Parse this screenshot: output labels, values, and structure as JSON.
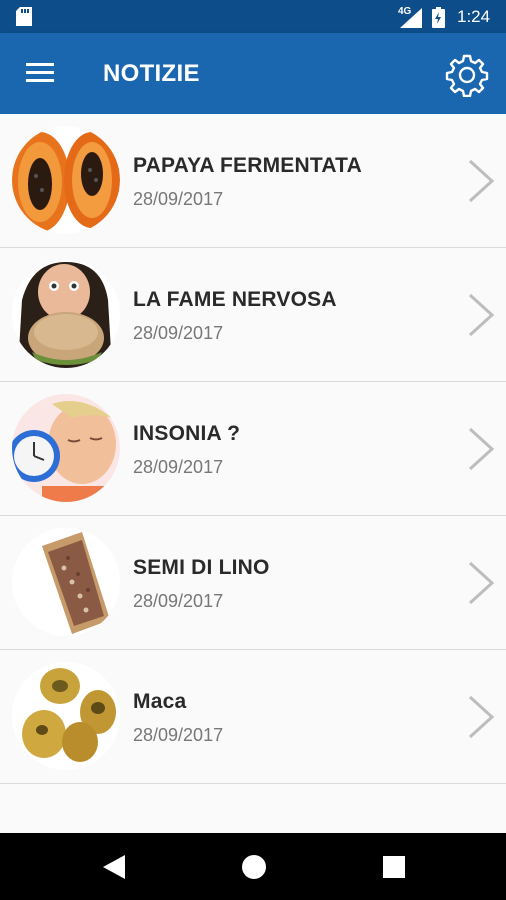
{
  "status_bar": {
    "network": "4G",
    "time": "1:24"
  },
  "app_bar": {
    "title": "NOTIZIE",
    "menu_icon": "hamburger-menu-icon",
    "settings_icon": "gear-icon"
  },
  "news": [
    {
      "title": "PAPAYA FERMENTATA",
      "date": "28/09/2017",
      "image": "papaya"
    },
    {
      "title": "LA FAME NERVOSA",
      "date": "28/09/2017",
      "image": "person-eating-bread"
    },
    {
      "title": "INSONIA ?",
      "date": "28/09/2017",
      "image": "sleeping-woman-alarm-clock"
    },
    {
      "title": "SEMI DI LINO",
      "date": "28/09/2017",
      "image": "flax-seeds-scoop"
    },
    {
      "title": "Maca",
      "date": "28/09/2017",
      "image": "maca-roots"
    }
  ],
  "nav_bar": {
    "back_icon": "back-triangle-icon",
    "home_icon": "home-circle-icon",
    "recents_icon": "recents-square-icon"
  },
  "colors": {
    "status_bar": "#0d4d8a",
    "app_bar": "#1a67b0",
    "background": "#fafafa"
  }
}
